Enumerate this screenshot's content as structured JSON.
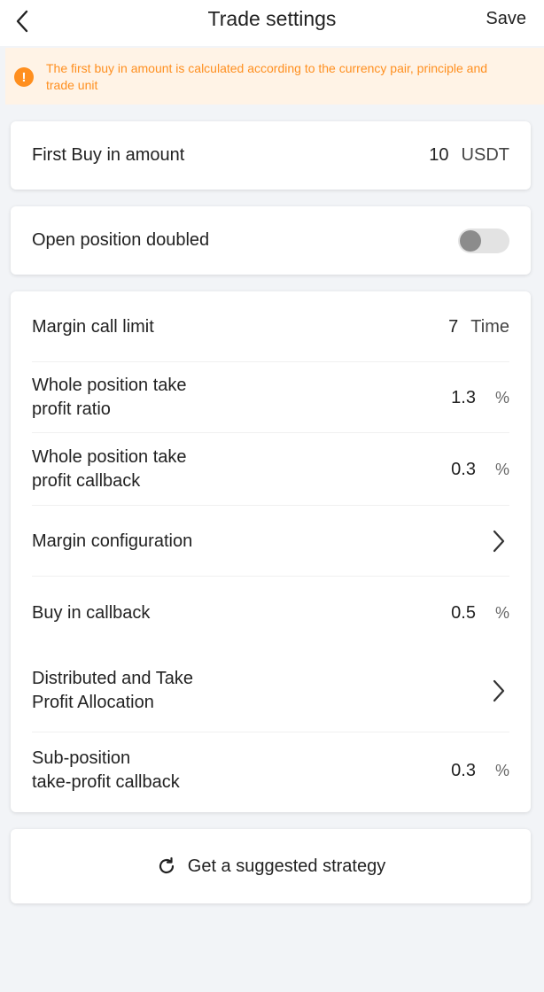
{
  "header": {
    "title": "Trade settings",
    "save_label": "Save"
  },
  "notice": {
    "icon": "!",
    "text": "The first buy in amount is calculated according to the currency pair, principle and trade unit"
  },
  "first_buy": {
    "label": "First Buy in amount",
    "value": "10",
    "unit": "USDT"
  },
  "open_position": {
    "label": "Open position doubled",
    "enabled": false
  },
  "settings": {
    "margin_call_limit": {
      "label": "Margin call limit",
      "value": "7",
      "unit": "Time"
    },
    "whole_tp_ratio": {
      "label_line1": "Whole position take",
      "label_line2": "profit ratio",
      "value": "1.3",
      "unit": "%"
    },
    "whole_tp_callback": {
      "label_line1": "Whole position take",
      "label_line2": "profit callback",
      "value": "0.3",
      "unit": "%"
    },
    "margin_config": {
      "label": "Margin configuration"
    },
    "buy_in_callback": {
      "label": "Buy in callback",
      "value": "0.5",
      "unit": "%"
    },
    "distributed_tp": {
      "label_line1": "Distributed and Take",
      "label_line2": "Profit Allocation"
    },
    "sub_position_callback": {
      "label_line1": "Sub-position",
      "label_line2": "take-profit callback",
      "value": "0.3",
      "unit": "%"
    }
  },
  "suggest": {
    "label": "Get a suggested strategy"
  },
  "colors": {
    "accent_orange": "#ff8f1f",
    "notice_bg": "#fff3e6",
    "page_bg": "#f2f4f7"
  }
}
